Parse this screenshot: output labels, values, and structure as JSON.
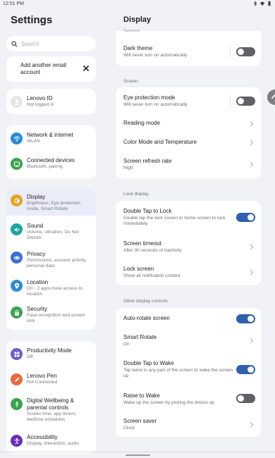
{
  "status_bar": {
    "time": "12:51 PM"
  },
  "left": {
    "title": "Settings",
    "search_placeholder": "Search",
    "email_label": "Add another email account",
    "account": {
      "title": "Lenovo ID",
      "subtitle": "Not logged in"
    },
    "items": [
      {
        "title": "Network & internet",
        "subtitle": "WLAN",
        "icon": "wifi-icon",
        "color": "#2a8bdb"
      },
      {
        "title": "Connected devices",
        "subtitle": "Bluetooth, pairing",
        "icon": "devices-icon",
        "color": "#3aa34e"
      },
      {
        "title": "Display",
        "subtitle": "Brightness, Eye protection mode, Smart Rotate",
        "icon": "brightness-icon",
        "color": "#e8a21f"
      },
      {
        "title": "Sound",
        "subtitle": "Volume, vibration, Do Not Disturb",
        "icon": "volume-icon",
        "color": "#1ca7a0"
      },
      {
        "title": "Privacy",
        "subtitle": "Permissions, account activity, personal data",
        "icon": "privacy-eye-icon",
        "color": "#3b6fd6"
      },
      {
        "title": "Location",
        "subtitle": "On - 2 apps have access to location",
        "icon": "location-icon",
        "color": "#2a8bdb"
      },
      {
        "title": "Security",
        "subtitle": "Face-recognition and screen lock",
        "icon": "lock-icon",
        "color": "#3aa34e"
      },
      {
        "title": "Productivity Mode",
        "subtitle": "Off",
        "icon": "productivity-icon",
        "color": "#6b5fc9"
      },
      {
        "title": "Lenovo Pen",
        "subtitle": "Not Connected",
        "icon": "pen-icon",
        "color": "#e86a3a"
      },
      {
        "title": "Digital Wellbeing & parental controls",
        "subtitle": "Screen time, app timers, bedtime schedules",
        "icon": "wellbeing-icon",
        "color": "#3aa34e"
      },
      {
        "title": "Accessibility",
        "subtitle": "Display, interaction, audio",
        "icon": "accessibility-icon",
        "color": "#6b2fb9"
      }
    ]
  },
  "right": {
    "title": "Display",
    "top_card": {
      "cut_label": "Settings",
      "dark_theme": {
        "title": "Dark theme",
        "subtitle": "Will never turn on automatically"
      }
    },
    "screen_section": {
      "label": "Screen",
      "eye_protection": {
        "title": "Eye protection mode",
        "subtitle": "Will never turn on automatically"
      },
      "reading_mode": {
        "title": "Reading mode"
      },
      "color_mode": {
        "title": "Color Mode and Temperature"
      },
      "refresh_rate": {
        "title": "Screen refresh rate",
        "subtitle": "High"
      }
    },
    "lock_section": {
      "label": "Lock display",
      "double_tap_lock": {
        "title": "Double Tap to Lock",
        "subtitle": "Double tap the lock screen or home screen to lock immediately"
      },
      "screen_timeout": {
        "title": "Screen timeout",
        "subtitle": "After 30 seconds of inactivity"
      },
      "lock_screen": {
        "title": "Lock screen",
        "subtitle": "Show all notification content"
      }
    },
    "other_section": {
      "label": "Other display controls",
      "auto_rotate": {
        "title": "Auto-rotate screen"
      },
      "smart_rotate": {
        "title": "Smart Rotate",
        "subtitle": "On"
      },
      "double_tap_wake": {
        "title": "Double Tap to Wake",
        "subtitle": "Tap twice in any part of the screen to wake the screen up"
      },
      "raise_to_wake": {
        "title": "Raise to Wake",
        "subtitle": "Wake up the screen by picking the device up"
      },
      "screen_saver": {
        "title": "Screen saver",
        "subtitle": "Clock"
      }
    }
  },
  "toggles": {
    "dark_theme": false,
    "eye_protection": false,
    "double_tap_lock": true,
    "auto_rotate": true,
    "double_tap_wake": true,
    "raise_to_wake": false
  },
  "colors": {
    "accent": "#2f5fad",
    "selected": "#eaecfa",
    "background": "#f1f2f6"
  }
}
